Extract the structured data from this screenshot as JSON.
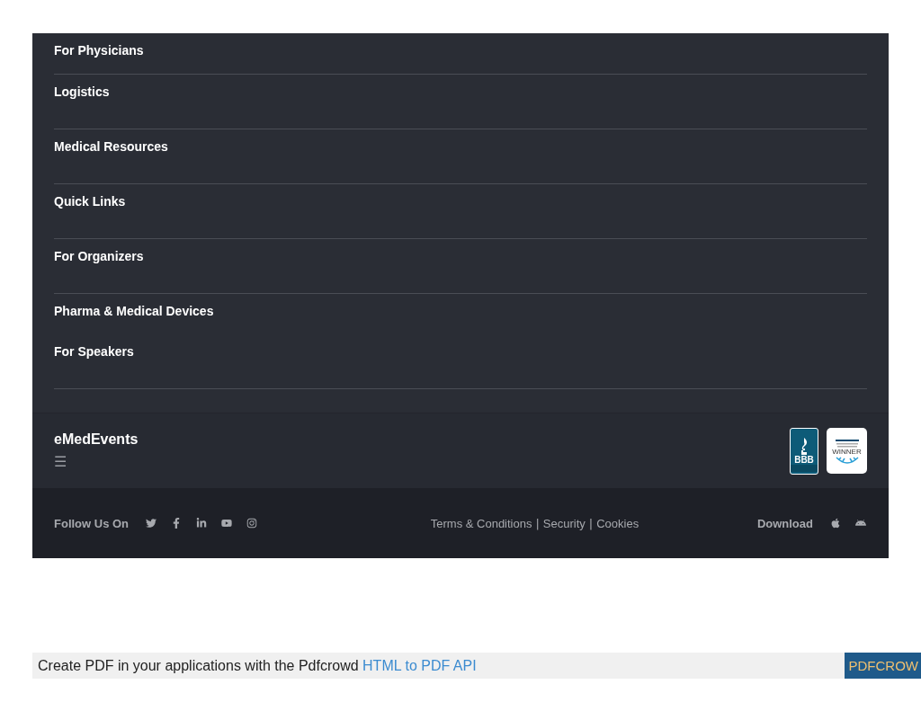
{
  "menu": [
    {
      "label": "For Physicians",
      "divider": true
    },
    {
      "label": "Logistics",
      "divider": true
    },
    {
      "label": "Medical Resources",
      "divider": true
    },
    {
      "label": "Quick Links",
      "divider": true
    },
    {
      "label": "For Organizers",
      "divider": true
    },
    {
      "label": "Pharma & Medical Devices",
      "divider": false
    },
    {
      "label": "For Speakers",
      "divider": true
    }
  ],
  "brand": {
    "name": "eMedEvents",
    "menu_glyph": "☰"
  },
  "badges": {
    "bbb": {
      "mark": "BBB"
    },
    "award": {
      "lines": [
        "WINNER"
      ]
    }
  },
  "footer": {
    "follow_label": "Follow Us On",
    "social": [
      {
        "kind": "twitter"
      },
      {
        "kind": "facebook"
      },
      {
        "kind": "linkedin"
      },
      {
        "kind": "youtube"
      },
      {
        "kind": "instagram"
      }
    ],
    "links": [
      "Terms & Conditions",
      "Security",
      "Cookies"
    ],
    "separator": "|",
    "download_label": "Download",
    "apps": [
      {
        "kind": "apple"
      },
      {
        "kind": "android"
      }
    ]
  },
  "pdf_bar": {
    "text": "Create PDF in your applications with the Pdfcrowd",
    "link": "HTML to PDF API",
    "button": "PDFCROW"
  }
}
